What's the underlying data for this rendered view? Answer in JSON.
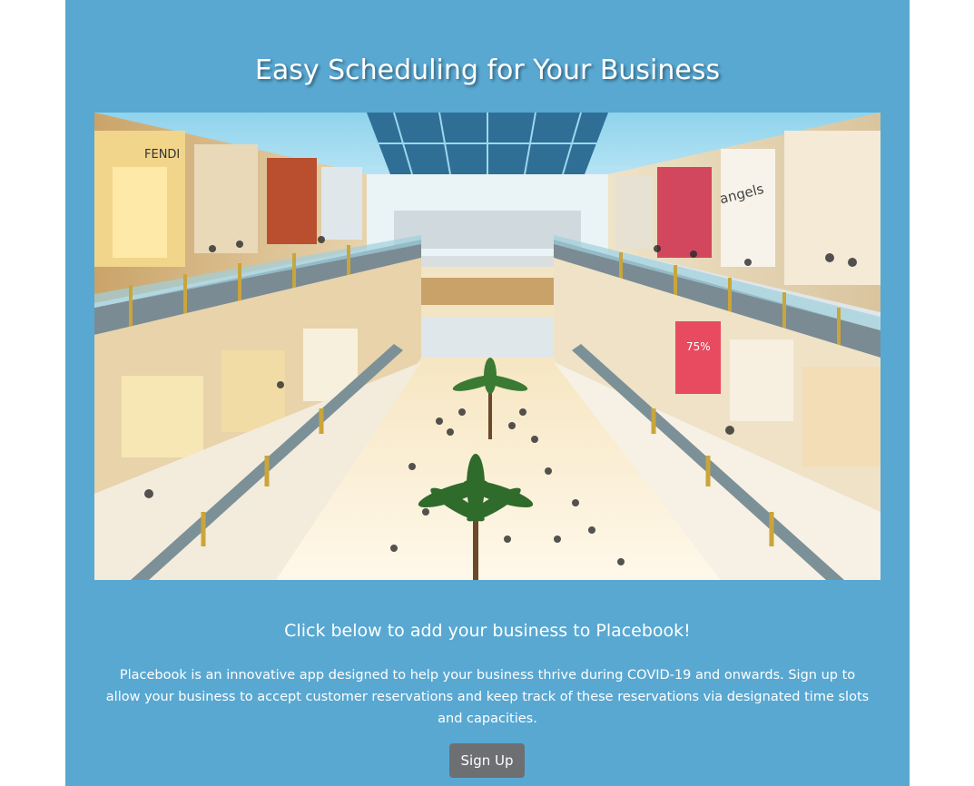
{
  "hero": {
    "title": "Easy Scheduling for Your Business",
    "image_alt": "Photo of a multi-level shopping mall interior",
    "signs": {
      "fendi": "FENDI",
      "angels": "angels",
      "sale": "75%"
    }
  },
  "content": {
    "subtitle": "Click below to add your business to Placebook!",
    "description": "Placebook is an innovative app designed to help your business thrive during COVID-19 and onwards. Sign up to allow your business to accept customer reservations and keep track of these reservations via designated time slots and capacities.",
    "signup_label": "Sign Up"
  },
  "colors": {
    "panel_background": "#58a8d2",
    "button_background": "#6d6f73",
    "text": "#ffffff"
  }
}
